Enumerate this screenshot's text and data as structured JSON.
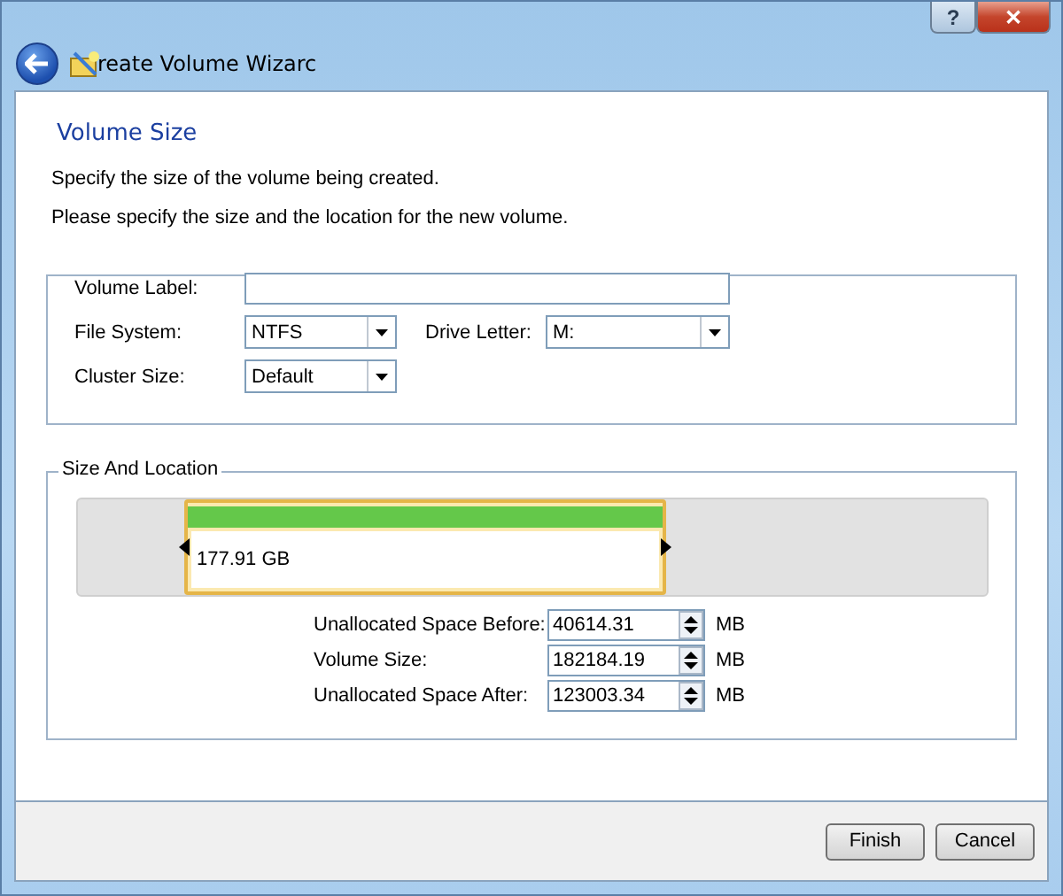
{
  "window": {
    "help": "?",
    "close": "✕",
    "title": "reate Volume Wizarc"
  },
  "page": {
    "heading": "Volume Size",
    "description": "Specify the size of the volume being created.",
    "instruction": "Please specify the size and the location for the new volume."
  },
  "volume_label": {
    "label": "Volume Label:"
  },
  "file_system": {
    "label": "File System:",
    "value": "NTFS"
  },
  "drive_letter": {
    "label": "Drive Letter:",
    "value": "M:"
  },
  "cluster_size": {
    "label": "Cluster Size:",
    "value": "Default"
  },
  "size_and_location": {
    "title": "Size And Location",
    "volume": {
      "size": "177.91 GB"
    },
    "fields": [
      {
        "label": "Unallocated Space Before:",
        "value": "40614.31",
        "unit": "MB"
      },
      {
        "label": "Volume Size:",
        "value": "182184.19",
        "unit": "MB"
      },
      {
        "label": "Unallocated Space After:",
        "value": "123003.34",
        "unit": "MB"
      }
    ]
  },
  "buttons": [
    {
      "label": "Finish"
    },
    {
      "label": "Cancel"
    }
  ]
}
